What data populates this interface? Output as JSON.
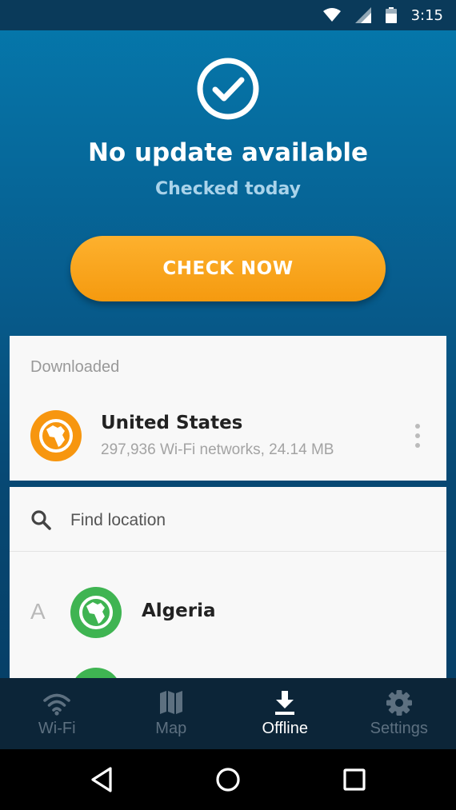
{
  "status_bar": {
    "time": "3:15",
    "icons": [
      "wifi-icon",
      "signal-icon",
      "battery-icon"
    ]
  },
  "hero": {
    "icon": "check-circle-icon",
    "title": "No update available",
    "subtitle": "Checked today",
    "button_label": "CHECK NOW"
  },
  "downloaded": {
    "section_label": "Downloaded",
    "items": [
      {
        "name": "United States",
        "detail": "297,936 Wi-Fi networks, 24.14 MB",
        "icon": "globe-africa-icon",
        "color": "#f7960f"
      }
    ]
  },
  "locations": {
    "search_placeholder": "Find location",
    "groups": [
      {
        "letter": "A",
        "items": [
          {
            "name": "Algeria",
            "icon": "globe-africa-icon",
            "color": "#3fb452"
          }
        ]
      }
    ]
  },
  "bottom_nav": {
    "items": [
      {
        "label": "Wi-Fi",
        "icon": "wifi-icon",
        "active": false
      },
      {
        "label": "Map",
        "icon": "map-icon",
        "active": false
      },
      {
        "label": "Offline",
        "icon": "download-icon",
        "active": true
      },
      {
        "label": "Settings",
        "icon": "gear-icon",
        "active": false
      }
    ]
  },
  "colors": {
    "accent": "#f7960f",
    "primary": "#0579ad",
    "nav_bg": "#0c2538",
    "success": "#3fb452"
  }
}
